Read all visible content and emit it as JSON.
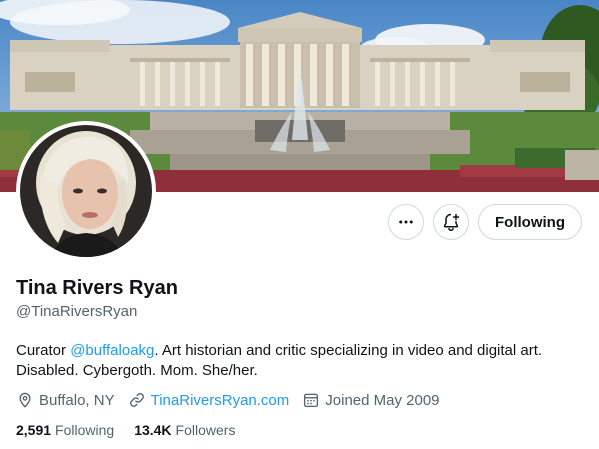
{
  "profile": {
    "display_name": "Tina Rivers Ryan",
    "handle": "@TinaRiversRyan",
    "bio": {
      "prefix": "Curator ",
      "mention": "@buffaloakg",
      "suffix": ". Art historian and critic specializing in video and digital art. Disabled. Cybergoth. Mom. She/her."
    },
    "location": "Buffalo, NY",
    "website": "TinaRiversRyan.com",
    "joined": "Joined May 2009",
    "stats": {
      "following_count": "2,591",
      "following_label": "Following",
      "followers_count": "13.4K",
      "followers_label": "Followers"
    }
  },
  "actions": {
    "following_label": "Following",
    "more_icon": "more-horizontal-icon",
    "notify_icon": "bell-plus-icon"
  },
  "colors": {
    "link": "#1d9bf0",
    "secondary_text": "#536471",
    "primary_text": "#0f1419",
    "border": "#cfd9de"
  }
}
